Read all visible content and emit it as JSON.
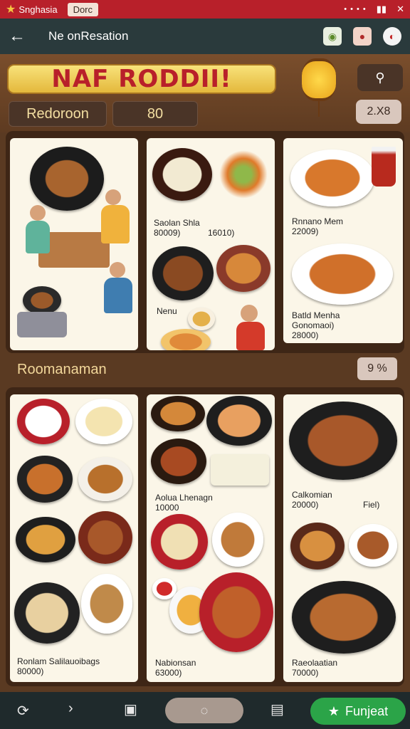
{
  "status_bar": {
    "app_name": "Snghasia",
    "tab2": "Dorc"
  },
  "title_bar": {
    "title": "Ne onResation"
  },
  "header": {
    "banner_text": "NAF RODDII!",
    "pill_left": "Redoroon",
    "pill_mid": "80",
    "price_badge": "2.X8"
  },
  "top_cards": {
    "card2": {
      "item1_name": "Saolan Shla",
      "item1_price": "80009)",
      "item1_price2": "16010)",
      "item2_name": "Nenu"
    },
    "card3": {
      "item1_name": "Rnnano Mem",
      "item1_price": "22009)",
      "item2_name": "Batld Menha",
      "item2_sub": "Gonomaoi)",
      "item2_price": "28000)"
    }
  },
  "section": {
    "title": "Roomanaman",
    "badge": "9 %"
  },
  "bottom_cards": {
    "card1": {
      "name": "Ronlam Salilauoibags",
      "price": "80000)"
    },
    "card2": {
      "item1_name": "Aolua Lhenagn",
      "item1_price": "10000",
      "item2_name": "Nabionsan",
      "item2_price": "63000)"
    },
    "card3": {
      "item1_name": "Calkomian",
      "item1_price": "20000)",
      "item1_extra": "Fiel)",
      "item2_name": "Raeolaatian",
      "item2_price": "70000)"
    }
  },
  "bottom_bar": {
    "cta_label": "Funjeat"
  },
  "icons": {
    "status_star": "star-icon",
    "back": "arrow-left-icon",
    "search": "search-icon",
    "nav_refresh": "refresh-icon",
    "nav_next": "chevron-right-icon",
    "nav_page": "page-icon",
    "nav_home": "home-circle-icon",
    "nav_clip": "clipboard-icon",
    "cta": "star-icon"
  },
  "colors": {
    "brand_red": "#b8202a",
    "accent_green": "#2ba448",
    "banner_yellow": "#f3d45a"
  }
}
